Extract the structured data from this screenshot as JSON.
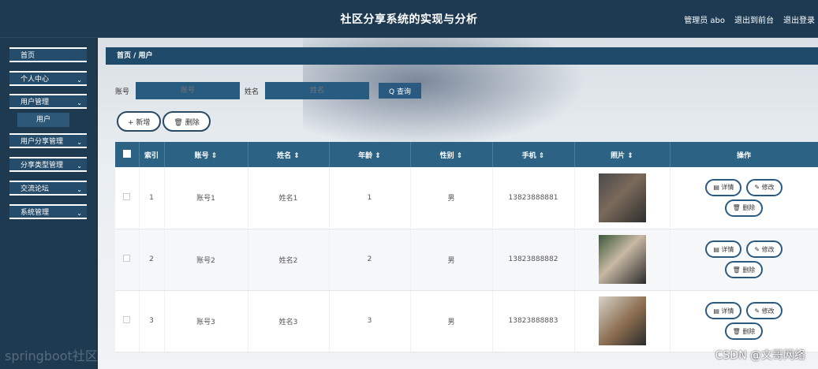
{
  "header": {
    "title": "社区分享系统的实现与分析",
    "admin": "管理员 abo",
    "to_frontend": "退出到前台",
    "logout": "退出登录"
  },
  "sidebar": {
    "items": [
      {
        "label": "首页"
      },
      {
        "label": "个人中心"
      },
      {
        "label": "用户管理"
      },
      {
        "label": "用户分享管理"
      },
      {
        "label": "分享类型管理"
      },
      {
        "label": "交流论坛"
      },
      {
        "label": "系统管理"
      }
    ],
    "sub_items": [
      {
        "label": "用户"
      }
    ],
    "chevron": "⌄"
  },
  "breadcrumb": "首页 / 用户",
  "search": {
    "account_label": "账号",
    "account_placeholder": "账号",
    "name_label": "姓名",
    "name_placeholder": "姓名",
    "button": "Q 查询"
  },
  "actions": {
    "add": "+ 新增",
    "delete": "🗑 删除"
  },
  "table": {
    "headers": [
      "",
      "索引",
      "账号 ⇕",
      "姓名 ⇕",
      "年龄 ⇕",
      "性别 ⇕",
      "手机 ⇕",
      "照片 ⇕",
      "操作"
    ],
    "rows": [
      {
        "index": "1",
        "account": "账号1",
        "name": "姓名1",
        "age": "1",
        "gender": "男",
        "phone": "13823888881"
      },
      {
        "index": "2",
        "account": "账号2",
        "name": "姓名2",
        "age": "2",
        "gender": "男",
        "phone": "13823888882"
      },
      {
        "index": "3",
        "account": "账号3",
        "name": "姓名3",
        "age": "3",
        "gender": "男",
        "phone": "13823888883"
      }
    ],
    "ops": {
      "detail": "▤ 详情",
      "edit": "✎ 修改",
      "delete": "🗑 删除"
    }
  },
  "watermarks": {
    "left": "springboot社区",
    "right": "CSDN @文哥网络"
  },
  "colors": {
    "primary": "#2c6283",
    "topbar": "#1d3a52",
    "sidebar": "#1e3a50"
  }
}
